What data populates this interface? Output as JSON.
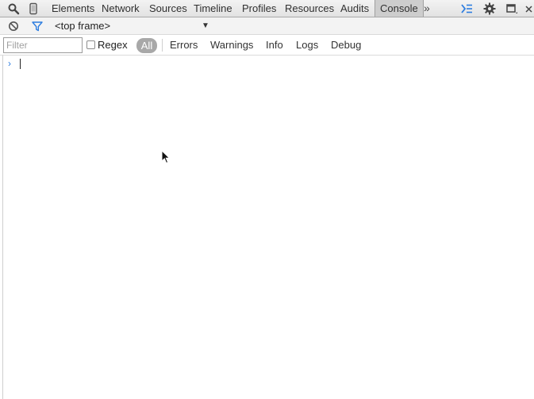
{
  "toolbar": {
    "tabs": [
      {
        "label": "Elements"
      },
      {
        "label": "Network"
      },
      {
        "label": "Sources"
      },
      {
        "label": "Timeline"
      },
      {
        "label": "Profiles"
      },
      {
        "label": "Resources"
      },
      {
        "label": "Audits"
      },
      {
        "label": "Console",
        "selected": true
      }
    ],
    "more_label": "»",
    "icons": [
      "search-icon",
      "device-mode-icon",
      "console-drawer-icon",
      "settings-gear-icon",
      "dock-icon",
      "close-icon"
    ],
    "accent_color": "#2d7de0"
  },
  "console_toolbar": {
    "frame_value": "<top frame>",
    "icons": [
      "clear-console-icon",
      "filter-funnel-icon"
    ]
  },
  "filter_bar": {
    "filter_placeholder": "Filter",
    "filter_value": "",
    "regex_label": "Regex",
    "levels": [
      {
        "label": "All",
        "selected": true
      },
      {
        "label": "Errors"
      },
      {
        "label": "Warnings"
      },
      {
        "label": "Info"
      },
      {
        "label": "Logs"
      },
      {
        "label": "Debug"
      }
    ]
  },
  "console": {
    "prompt_symbol": "›",
    "input_value": ""
  }
}
